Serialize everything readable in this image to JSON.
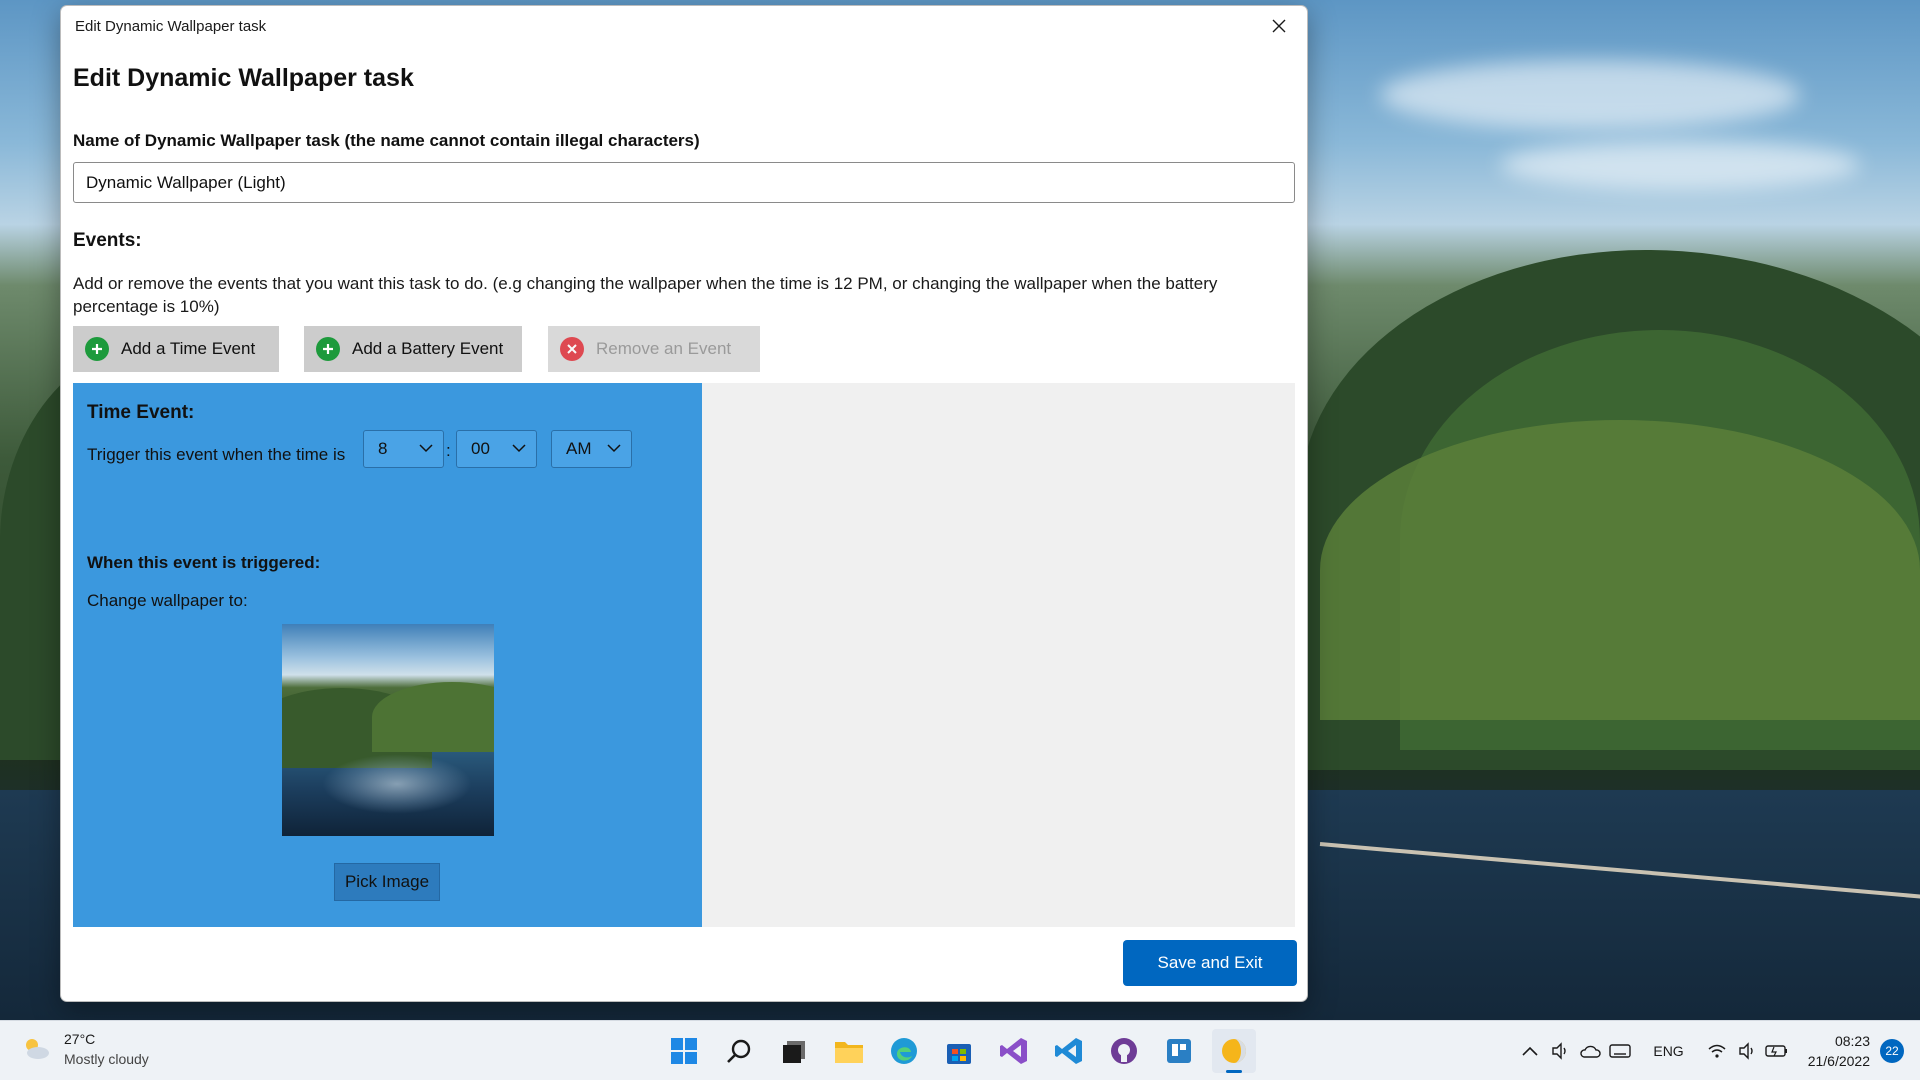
{
  "window": {
    "title": "Edit Dynamic Wallpaper task",
    "heading": "Edit Dynamic Wallpaper task",
    "name_label": "Name of Dynamic Wallpaper task (the name cannot contain illegal characters)",
    "name_value": "Dynamic Wallpaper (Light)",
    "events_label": "Events:",
    "events_description": "Add or remove the events that you want this task to do. (e.g changing the wallpaper when the time is 12 PM, or changing the wallpaper when the battery percentage is 10%)",
    "buttons": {
      "add_time": "Add a Time Event",
      "add_battery": "Add a Battery Event",
      "remove": "Remove an Event"
    },
    "event": {
      "title": "Time Event:",
      "trigger_label": "Trigger this event when the time is",
      "hour": "8",
      "minute": "00",
      "period": "AM",
      "separator": ":",
      "when_label": "When this event is triggered:",
      "change_label": "Change wallpaper to:",
      "pick_button": "Pick Image"
    },
    "save_button": "Save and Exit"
  },
  "taskbar": {
    "weather_temp": "27°C",
    "weather_condition": "Mostly cloudy",
    "apps": [
      "start-icon",
      "search-icon",
      "task-view-icon",
      "file-explorer-icon",
      "edge-icon",
      "store-icon",
      "visual-studio-icon",
      "vscode-icon",
      "github-icon",
      "app-icon",
      "dynamic-wallpaper-icon"
    ],
    "language": "ENG",
    "time": "08:23",
    "date": "21/6/2022",
    "notifications": "22"
  },
  "colors": {
    "event_card": "#3b98de",
    "accent": "#0067c0",
    "add_icon": "#1d9a3c",
    "remove_icon": "#e0303a"
  }
}
